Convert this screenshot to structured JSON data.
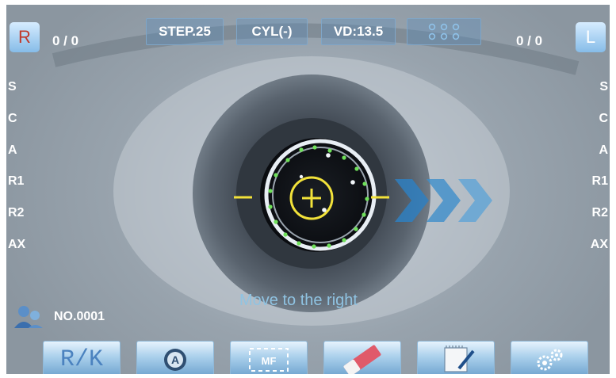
{
  "top_bar": {
    "right_eye_label": "R",
    "right_count": "0 / 0",
    "step": "STEP.25",
    "cyl": "CYL(-)",
    "vd": "VD:13.5",
    "left_count": "0 / 0",
    "left_eye_label": "L"
  },
  "params_left": [
    "S",
    "C",
    "A",
    "R1",
    "R2",
    "AX"
  ],
  "params_right": [
    "S",
    "C",
    "A",
    "R1",
    "R2",
    "AX"
  ],
  "prompt": "Move to the right",
  "patient": {
    "number": "NO.0001",
    "icon": "patient-icon"
  },
  "bottom_bar": {
    "rk_label": "R/K",
    "buttons": [
      "rk-button",
      "auto-mode-icon",
      "manual-focus-icon",
      "eraser-icon",
      "notepad-icon",
      "settings-gears-icon"
    ],
    "mf_label": "MF",
    "auto_label": "A"
  },
  "colors": {
    "accent_blue": "#4b9fd6",
    "target_yellow": "#f2e23a",
    "led_green": "#6fe05a",
    "prompt_blue": "#8fc3e2"
  }
}
